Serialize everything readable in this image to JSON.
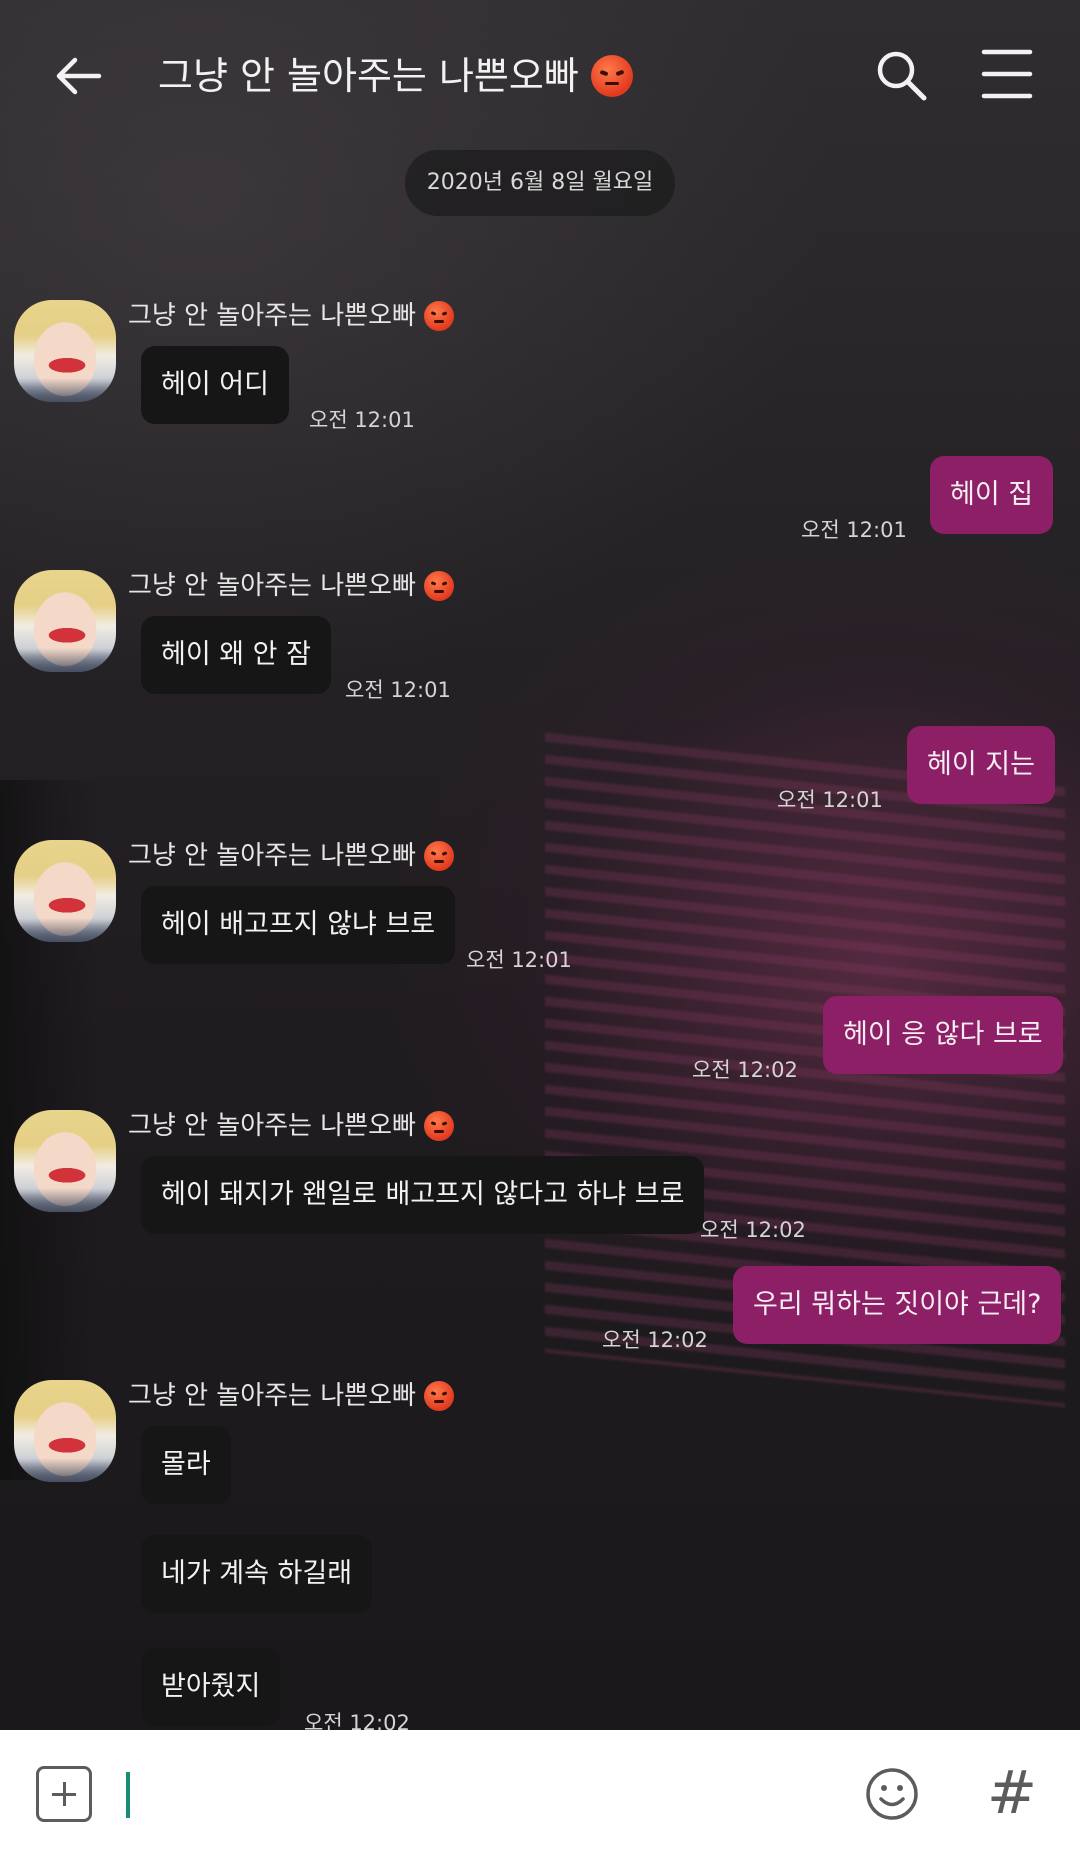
{
  "header": {
    "title": "그냥 안 놀아주는 나쁜오빠",
    "title_emoji": "angry-face"
  },
  "date_divider": "2020년 6월 8일 월요일",
  "messages": [
    {
      "side": "in",
      "sender": "그냥 안 놀아주는 나쁜오빠",
      "text": "헤이 어디",
      "time": "오전 12:01"
    },
    {
      "side": "out",
      "text": "헤이 집",
      "time": "오전 12:01"
    },
    {
      "side": "in",
      "sender": "그냥 안 놀아주는 나쁜오빠",
      "text": "헤이 왜 안 잠",
      "time": "오전 12:01"
    },
    {
      "side": "out",
      "text": "헤이 지는",
      "time": "오전 12:01"
    },
    {
      "side": "in",
      "sender": "그냥 안 놀아주는 나쁜오빠",
      "text": "헤이 배고프지 않냐 브로",
      "time": "오전 12:01"
    },
    {
      "side": "out",
      "text": "헤이 응 않다 브로",
      "time": "오전 12:02"
    },
    {
      "side": "in",
      "sender": "그냥 안 놀아주는 나쁜오빠",
      "text": "헤이 돼지가 왠일로 배고프지 않다고 하냐 브로",
      "time": "오전 12:02"
    },
    {
      "side": "out",
      "text": "우리 뭐하는 짓이야 근데?",
      "time": "오전 12:02"
    },
    {
      "side": "in",
      "sender": "그냥 안 놀아주는 나쁜오빠",
      "text": "몰라"
    },
    {
      "side": "in",
      "text": "네가 계속 하길래"
    },
    {
      "side": "in",
      "text": "받아줬지",
      "time": "오전 12:02"
    }
  ],
  "input_bar": {
    "placeholder": "",
    "attach_icon": "plus-square-icon",
    "emoji_icon": "smiley-icon",
    "hashtag_label": "#"
  },
  "colors": {
    "outgoing_bubble": "#8d1f66",
    "incoming_bubble": "#161616",
    "caret": "#1c8a78"
  }
}
